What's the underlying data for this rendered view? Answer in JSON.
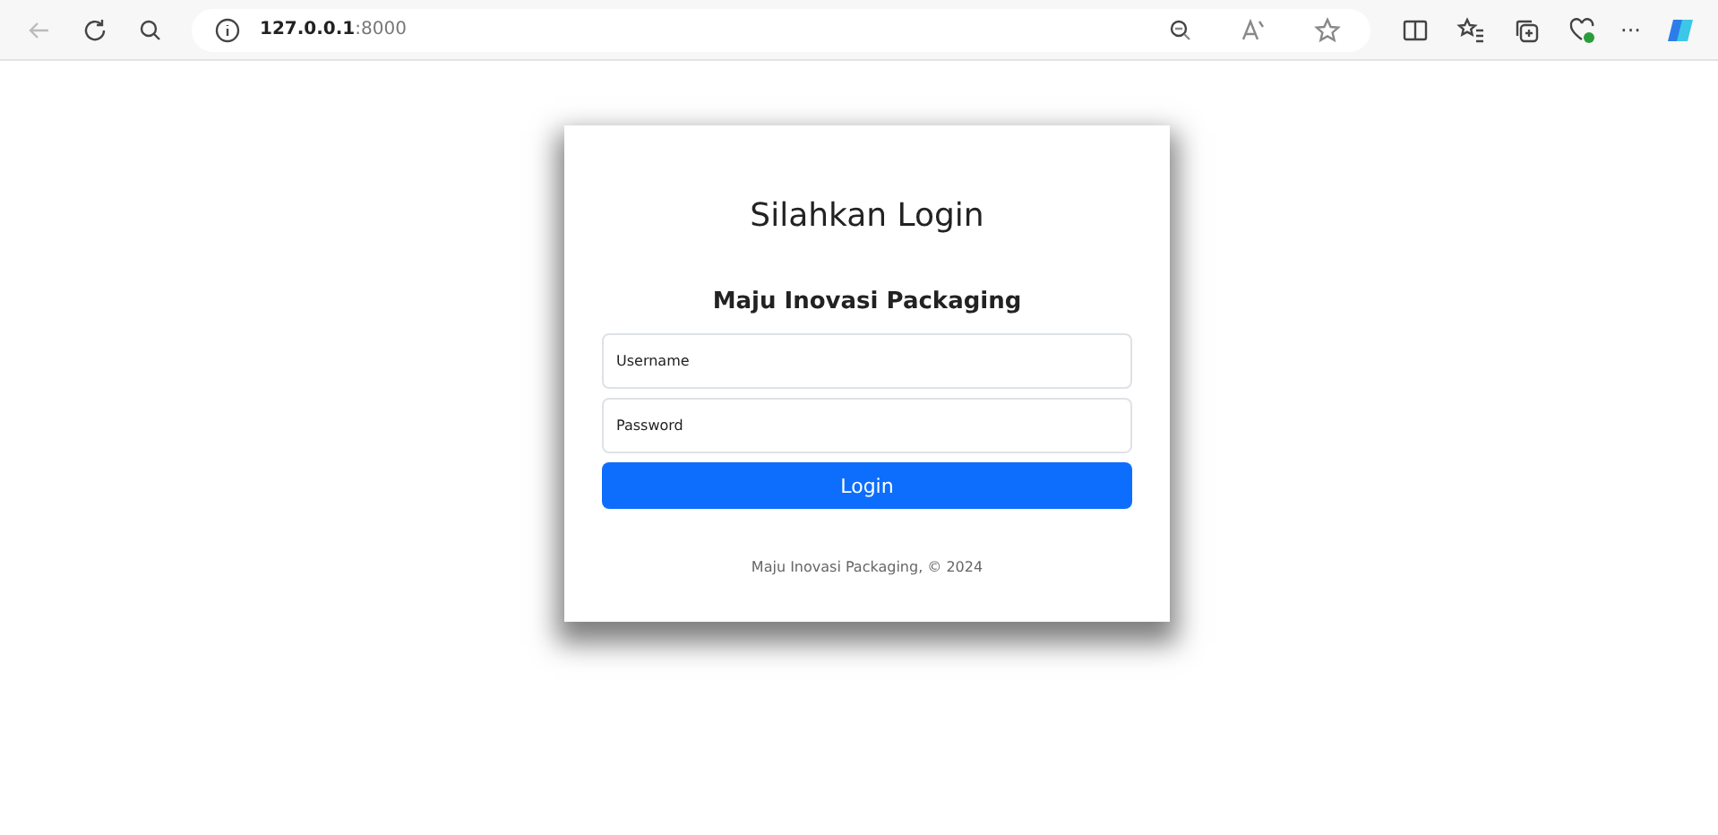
{
  "browser": {
    "url_host": "127.0.0.1",
    "url_port": ":8000",
    "more": "···"
  },
  "login": {
    "title": "Silahkan Login",
    "company": "Maju Inovasi Packaging",
    "fields": [
      {
        "placeholder": "Username"
      },
      {
        "placeholder": "Password"
      }
    ],
    "button": "Login",
    "footer": "Maju Inovasi Packaging, © 2024"
  }
}
